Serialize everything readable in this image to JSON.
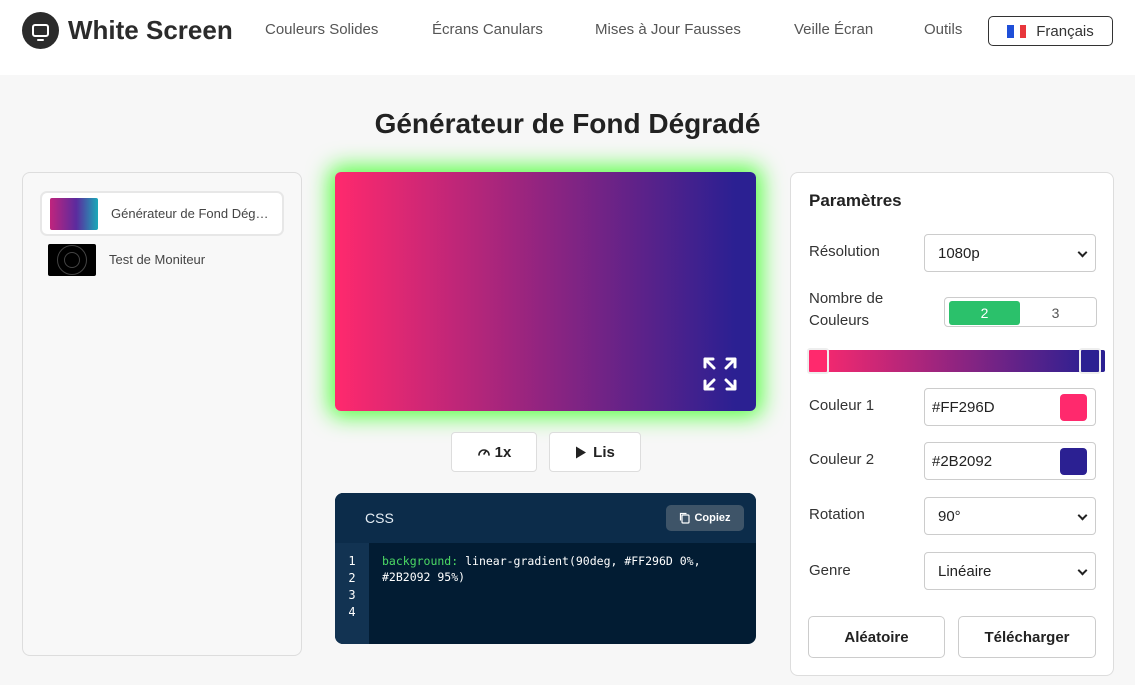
{
  "header": {
    "logo_text": "White Screen",
    "nav": [
      "Couleurs Solides",
      "Écrans Canulars",
      "Mises à Jour Fausses",
      "Veille Écran",
      "Outils"
    ],
    "language": "Français"
  },
  "page_title": "Générateur de Fond Dégradé",
  "sidebar": {
    "items": [
      {
        "label": "Générateur de Fond Dégradé",
        "icon": "gradient-thumbnail",
        "active": true
      },
      {
        "label": "Test de Moniteur",
        "icon": "monitor-test-thumbnail",
        "active": false
      }
    ]
  },
  "preview": {
    "colors": [
      "#FF296D",
      "#2B2092"
    ],
    "glow_color": "#5dff4a",
    "fullscreen_icon": "fullscreen-icon"
  },
  "controls": {
    "speed_label": "1x",
    "play_label": "Lis"
  },
  "css_box": {
    "label": "CSS",
    "copy_label": "Copiez",
    "line_numbers": [
      "1",
      "2",
      "3",
      "4"
    ],
    "property": "background:",
    "value_line1": " linear-gradient(90deg, #FF296D 0%,",
    "value_line2": "#2B2092 95%)"
  },
  "settings": {
    "title": "Paramètres",
    "resolution_label": "Résolution",
    "resolution_value": "1080p",
    "count_label": "Nombre de Couleurs",
    "count_options": [
      "2",
      "3"
    ],
    "count_selected": "2",
    "color1_label": "Couleur 1",
    "color1_value": "#FF296D",
    "color2_label": "Couleur 2",
    "color2_value": "#2B2092",
    "rotation_label": "Rotation",
    "rotation_value": "90°",
    "type_label": "Genre",
    "type_value": "Linéaire",
    "random_label": "Aléatoire",
    "download_label": "Télécharger",
    "accent_color": "#2bc16b"
  }
}
